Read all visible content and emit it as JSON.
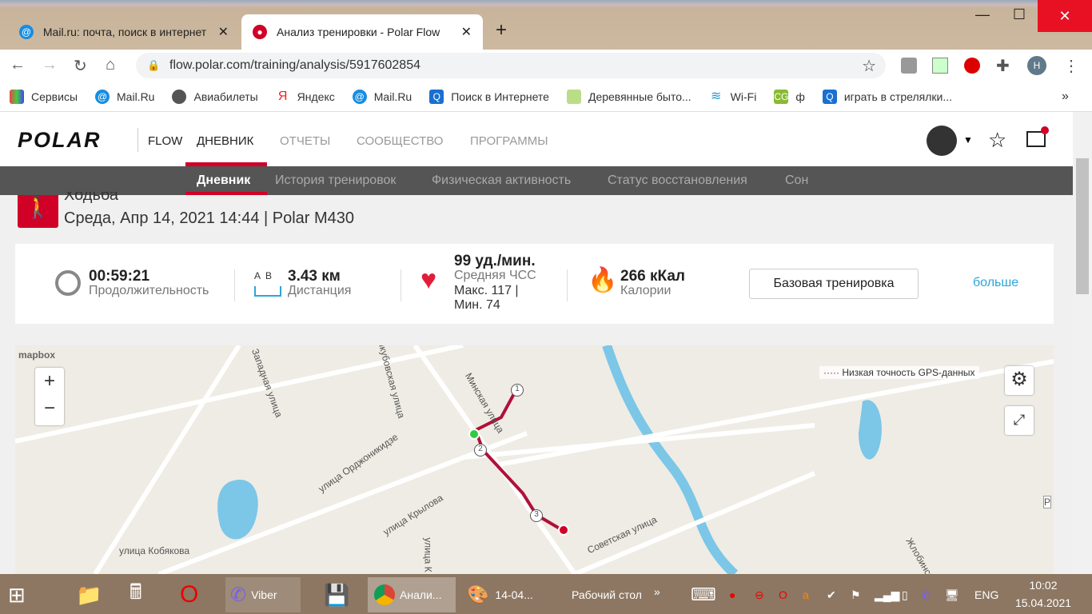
{
  "browser": {
    "tabs": [
      {
        "title": "Mail.ru: почта, поиск в интернет",
        "active": false
      },
      {
        "title": "Анализ тренировки - Polar Flow",
        "active": true
      }
    ],
    "url": "flow.polar.com/training/analysis/5917602854",
    "profile_initial": "Н",
    "bookmarks": [
      "Сервисы",
      "Mail.Ru",
      "Авиабилеты",
      "Яндекс",
      "Mail.Ru",
      "Поиск в Интернете",
      "Деревянные быто...",
      "Wi-Fi",
      "ф",
      "играть в стрелялки..."
    ]
  },
  "polar": {
    "logo": "POLAR",
    "flow": "FLOW",
    "nav": [
      "ДНЕВНИК",
      "ОТЧЕТЫ",
      "СООБЩЕСТВО",
      "ПРОГРАММЫ"
    ],
    "subnav": [
      "Дневник",
      "История тренировок",
      "Физическая активность",
      "Статус восстановления",
      "Сон"
    ]
  },
  "training": {
    "sport": "Ходьба",
    "subtitle": "Среда, Апр 14, 2021 14:44 | Polar M430"
  },
  "summary": {
    "duration": "00:59:21",
    "duration_label": "Продолжительность",
    "ab": "A  B",
    "distance": "3.43 км",
    "distance_label": "Дистанция",
    "hr": "99 уд./мин.",
    "hr_label": "Средняя ЧСС",
    "hr_max": "Макс. 117  |",
    "hr_min": "Мин. 74",
    "calories": "266 кКал",
    "calories_label": "Калории",
    "type_button": "Базовая тренировка",
    "more": "больше"
  },
  "map": {
    "attribution": "mapbox",
    "legend": "Низкая точность GPS-данных",
    "zoom_in": "+",
    "zoom_out": "−",
    "streets": [
      "Западная улица",
      "Минская улица",
      "улица Орджоникидзе",
      "улица Крылова",
      "улица Кобякова",
      "Советская улица",
      "улица К",
      "Жлобинская",
      "Якубовская улица",
      "Р"
    ],
    "markers": [
      "1",
      "2",
      "3"
    ]
  },
  "taskbar": {
    "viber": "Viber",
    "chrome": "Анали...",
    "paint": "14-04...",
    "desktop": "Рабочий стол",
    "lang": "ENG",
    "time": "10:02",
    "date": "15.04.2021"
  }
}
